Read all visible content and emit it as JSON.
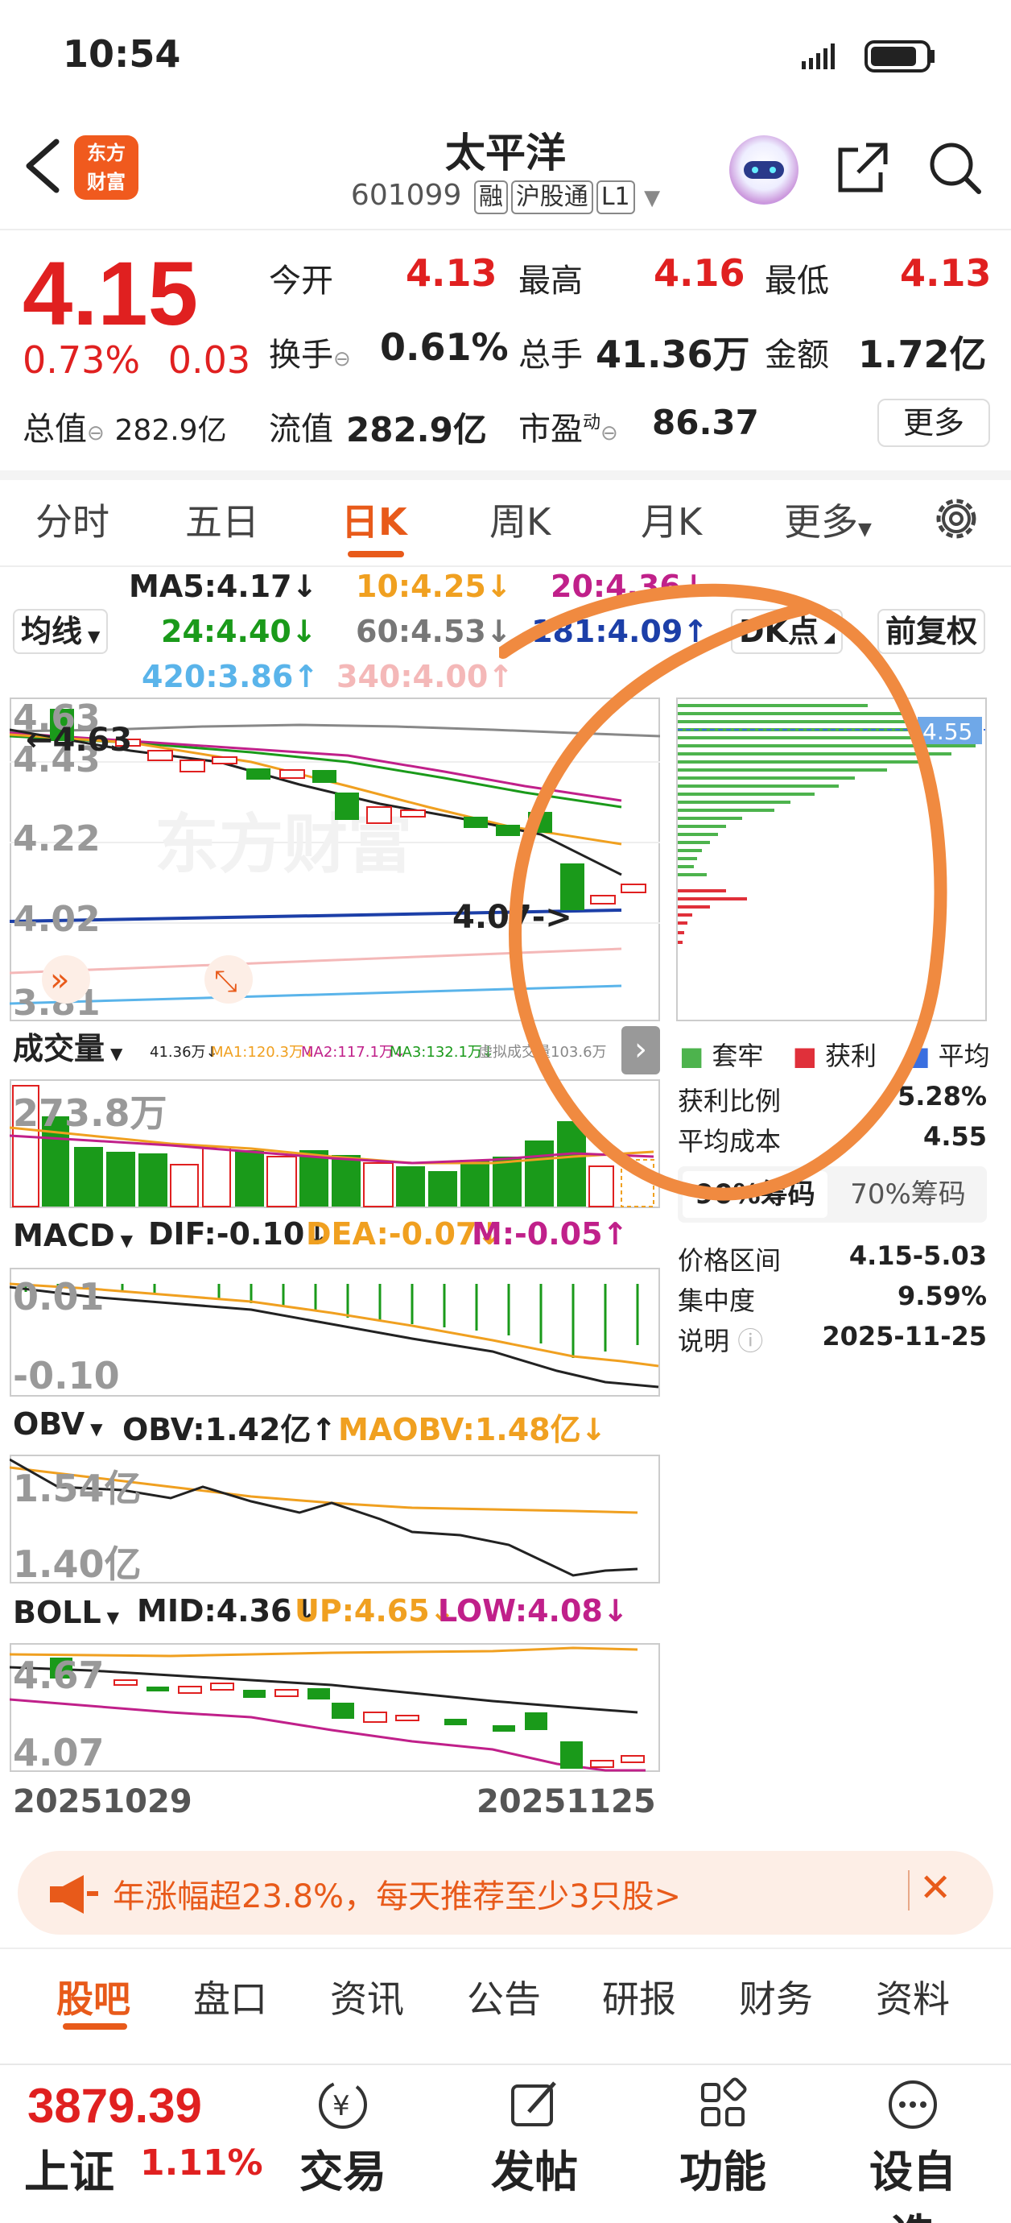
{
  "status": {
    "time": "10:54"
  },
  "header": {
    "logo_text_line1": "东方",
    "logo_text_line2": "财富",
    "stock_name": "太平洋",
    "stock_code": "601099",
    "tags": [
      "融",
      "沪股通",
      "L1"
    ]
  },
  "quote": {
    "price": "4.15",
    "change_pct": "0.73%",
    "change_abs": "0.03",
    "open_label": "今开",
    "open": "4.13",
    "high_label": "最高",
    "high": "4.16",
    "low_label": "最低",
    "low": "4.13",
    "turnover_label": "换手",
    "turnover": "0.61%",
    "volume_label": "总手",
    "volume": "41.36万",
    "amount_label": "金额",
    "amount": "1.72亿",
    "total_cap_label": "总值",
    "total_cap": "282.9亿",
    "float_cap_label": "流值",
    "float_cap": "282.9亿",
    "pe_label": "市盈",
    "pe_sup": "动",
    "pe": "86.37",
    "more_label": "更多"
  },
  "period_tabs": {
    "items": [
      "分时",
      "五日",
      "日K",
      "周K",
      "月K",
      "更多"
    ],
    "active": "日K"
  },
  "ma": {
    "selector": "均线",
    "ma5": "MA5:4.17↓",
    "ma10": "10:4.25↓",
    "ma20": "20:4.36↓",
    "ma24": "24:4.40↓",
    "ma60": "60:4.53↓",
    "ma181": "181:4.09↑",
    "ma420": "420:3.86↑",
    "ma340": "340:4.00↑",
    "dk_button": "DK点",
    "adjust_button": "前复权"
  },
  "main_chart": {
    "y_labels": [
      "4.63",
      "4.43",
      "4.22",
      "4.02",
      "3.81"
    ],
    "high_marker": "4.63",
    "low_marker": "4.07->",
    "watermark": "东方财富"
  },
  "chip": {
    "price_marker": "4.55",
    "legend": [
      "套牢",
      "获利",
      "平均"
    ],
    "profit_ratio_label": "获利比例",
    "profit_ratio": "5.28%",
    "avg_cost_label": "平均成本",
    "avg_cost": "4.55",
    "tab_90": "90%筹码",
    "tab_70": "70%筹码",
    "range_label": "价格区间",
    "range": "4.15-5.03",
    "concentration_label": "集中度",
    "concentration": "9.59%",
    "note_label": "说明",
    "date": "2025-11-25"
  },
  "volume_panel": {
    "selector": "成交量",
    "stats": "41.36万↓",
    "ma1": "MA1:120.3万↓",
    "ma2": "MA2:117.1万↓",
    "ma3": "MA3:132.1万↓",
    "virtual": "虚拟成交量103.6万",
    "y_label": "273.8万"
  },
  "macd_panel": {
    "selector": "MACD",
    "dif": "DIF:-0.10↓",
    "dea": "DEA:-0.07↓",
    "m": "M:-0.05↑",
    "y_labels": [
      "0.01",
      "-0.10"
    ]
  },
  "obv_panel": {
    "selector": "OBV",
    "obv": "OBV:1.42亿↑",
    "maobv": "MAOBV:1.48亿↓",
    "y_labels": [
      "1.54亿",
      "1.40亿"
    ]
  },
  "boll_panel": {
    "selector": "BOLL",
    "mid": "MID:4.36↓",
    "up": "UP:4.65↓",
    "low": "LOW:4.08↓",
    "y_labels": [
      "4.67",
      "4.07"
    ]
  },
  "x_axis": {
    "start": "20251029",
    "end": "20251125"
  },
  "promo": {
    "text": "年涨幅超23.8%，每天推荐至少3只股>"
  },
  "bottom_tabs": {
    "items": [
      "股吧",
      "盘口",
      "资讯",
      "公告",
      "研报",
      "财务",
      "资料"
    ],
    "active": "股吧"
  },
  "bottom_nav": {
    "index_value": "3879.39",
    "index_name": "上证",
    "index_change": "1.11%",
    "items": [
      "交易",
      "发帖",
      "功能",
      "设自选"
    ]
  },
  "colors": {
    "up": "#e02020",
    "down": "#1a9a1a",
    "accent": "#e85a1a",
    "ma5": "#222222",
    "ma10": "#f0a020",
    "ma20": "#c0208a",
    "ma60": "#888888",
    "ma181": "#1c3fa8",
    "ma420": "#5ab4ea"
  }
}
